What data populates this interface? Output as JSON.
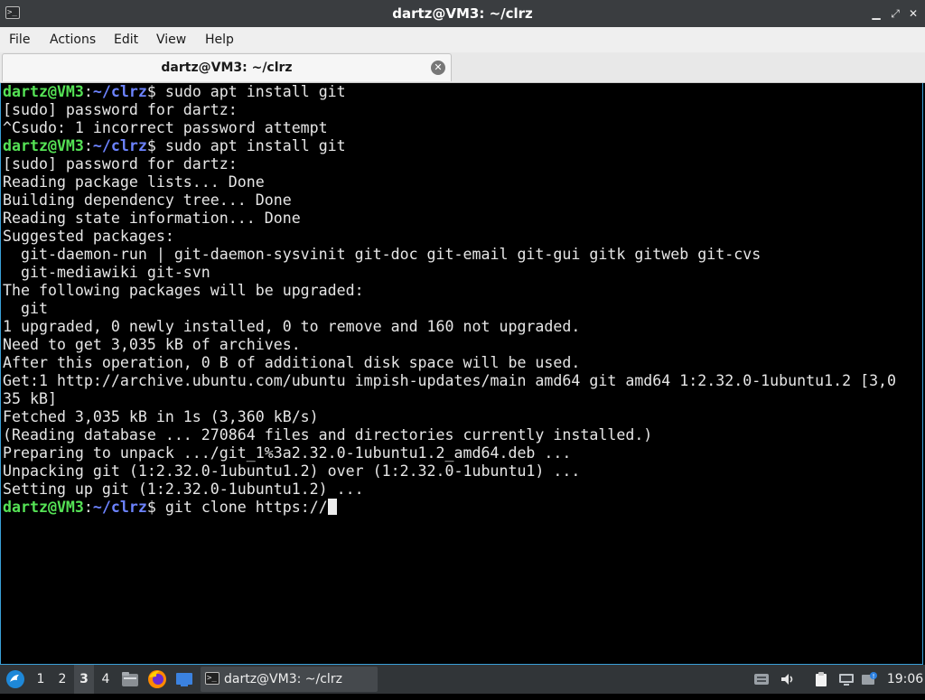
{
  "window": {
    "title": "dartz@VM3: ~/clrz",
    "app_icon": ">_",
    "controls": {
      "minimize": "▁",
      "maximize": "⤢",
      "close": "✕"
    }
  },
  "menu": {
    "file": "File",
    "actions": "Actions",
    "edit": "Edit",
    "view": "View",
    "help": "Help"
  },
  "tab": {
    "label": "dartz@VM3: ~/clrz",
    "close": "✕"
  },
  "terminal": {
    "colors": {
      "user": "#55e255",
      "path": "#6c83ff",
      "text": "#e6e6e6",
      "background": "#000000"
    },
    "prompt": {
      "user": "dartz@VM3",
      "sep": ":",
      "path": "~/clrz",
      "sign": "$ "
    },
    "cmd1": "sudo apt install git",
    "cmd2": "sudo apt install git",
    "cmd3": "git clone https://",
    "lines": [
      "[sudo] password for dartz:",
      "^Csudo: 1 incorrect password attempt",
      "[sudo] password for dartz:",
      "Reading package lists... Done",
      "Building dependency tree... Done",
      "Reading state information... Done",
      "Suggested packages:",
      "  git-daemon-run | git-daemon-sysvinit git-doc git-email git-gui gitk gitweb git-cvs",
      "  git-mediawiki git-svn",
      "The following packages will be upgraded:",
      "  git",
      "1 upgraded, 0 newly installed, 0 to remove and 160 not upgraded.",
      "Need to get 3,035 kB of archives.",
      "After this operation, 0 B of additional disk space will be used.",
      "Get:1 http://archive.ubuntu.com/ubuntu impish-updates/main amd64 git amd64 1:2.32.0-1ubuntu1.2 [3,0",
      "35 kB]",
      "Fetched 3,035 kB in 1s (3,360 kB/s)",
      "(Reading database ... 270864 files and directories currently installed.)",
      "Preparing to unpack .../git_1%3a2.32.0-1ubuntu1.2_amd64.deb ...",
      "Unpacking git (1:2.32.0-1ubuntu1.2) over (1:2.32.0-1ubuntu1) ...",
      "Setting up git (1:2.32.0-1ubuntu1.2) ..."
    ]
  },
  "taskbar": {
    "start_icon": "lubuntu-logo-icon",
    "workspaces": [
      "1",
      "2",
      "3",
      "4"
    ],
    "active_workspace": "3",
    "launchers": [
      "file-manager-icon",
      "firefox-icon",
      "desktop-icon"
    ],
    "task_label": "dartz@VM3: ~/clrz",
    "task_icon": ">_",
    "tray": [
      "keyboard-icon",
      "volume-icon",
      "clipboard-icon",
      "network-icon",
      "update-notifier-icon"
    ],
    "clock": "19:06"
  }
}
